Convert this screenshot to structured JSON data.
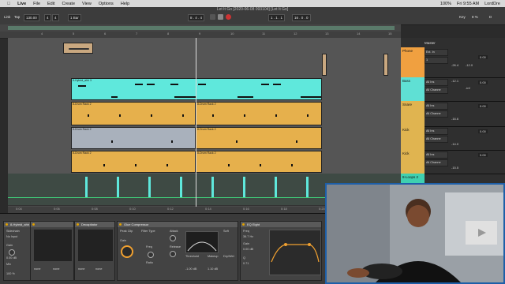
{
  "menubar": {
    "apple": "",
    "app": "Live",
    "items": [
      "File",
      "Edit",
      "Create",
      "View",
      "Options",
      "Help"
    ],
    "percent": "100%",
    "clock": "Fri 9:55 AM",
    "user": "LordDre"
  },
  "transport": {
    "title": "Let It Go  [2020-06-08 093104]  [Let It Go]",
    "link": "Link",
    "tap": "Tap",
    "tempo": "130.00",
    "sig_num": "4",
    "sig_den": "4",
    "bar": "1 Bar",
    "position": "8 . 4 . 4",
    "loop_start": "1 . 1 . 1",
    "loop_len": "16 . 0 . 0",
    "key": "Key",
    "cpu": "8 %",
    "midi": "D"
  },
  "ruler": [
    "4",
    "5",
    "6",
    "7",
    "8",
    "9",
    "10",
    "11",
    "12",
    "13",
    "14",
    "15"
  ],
  "timeline": [
    "0:04",
    "0:06",
    "0:08",
    "0:10",
    "0:12",
    "0:14",
    "0:16",
    "0:18",
    "0:20",
    "0:22"
  ],
  "clips": {
    "bass": "8-Hybrid_ahh 3",
    "snare1": "8-Drum Rack 2",
    "snare2": "8-Drum Rack 2",
    "kick1": "8-Drum Rack 2",
    "kick2": "8-Drum Rack 2",
    "kick3": "8-Drum Rack 2",
    "kick4": "8-Drum Rack 2"
  },
  "mixer": {
    "master": "Master",
    "tracks": [
      {
        "name": "Phone",
        "color": "#f0a040",
        "input": "Ext. In",
        "ch": "1",
        "db": "0.00",
        "vol": "-26.4",
        "pan": "-12.0"
      },
      {
        "name": "Bass",
        "color": "#5fe0d4",
        "input": "All Ins",
        "ch": "All Channe",
        "db": "0.00",
        "vol": "-12.1",
        "pan": "C"
      },
      {
        "name": "Snare",
        "color": "#e0b450",
        "input": "All Ins",
        "ch": "All Channe",
        "db": "0.00",
        "vol": "-16.6",
        "pan": "C"
      },
      {
        "name": "Kick",
        "color": "#e0b450",
        "input": "All Ins",
        "ch": "All Channe",
        "db": "0.00",
        "vol": "-14.0",
        "pan": "C"
      },
      {
        "name": "Kick",
        "color": "#e0b450",
        "input": "All Ins",
        "ch": "All Channe",
        "db": "0.00",
        "vol": "-15.5",
        "pan": "C"
      }
    ],
    "extra": "8-Loops 2",
    "sends": "-inf"
  },
  "devices": {
    "hybrid": "8-Hybrid_ahh 3",
    "sidechain": "Sidechain",
    "no_input": "No Input",
    "gain": "Gain",
    "mix": "Mix",
    "decapitator": "Decapitator",
    "glue": "Glue Compressor",
    "eq": "EQ Eight",
    "attack": "Attack",
    "release": "Release",
    "ratio": "Ratio",
    "threshold": "Threshold",
    "makeup": "Makeup",
    "threshold_val": "-1.00 dB",
    "makeup_val": "1.10 dB",
    "peak_clip": "Peak Clip",
    "filter_type": "Filter Type",
    "freq": "Freq",
    "freq_val": "36.7 Hz",
    "eq_gain": "Gain",
    "eq_gain_val": "0.00 dB",
    "q": "Q",
    "q_val": "0.71",
    "dry_wet": "Dry/Wet",
    "dry_wet_val": "100 %",
    "mode": "Mode",
    "gain_val": "0.00 dB",
    "soft": "Soft",
    "none": "none",
    "range": "Range",
    "scale": "Scale",
    "adapt": "Adapt Q",
    "on": "On"
  },
  "colors": {
    "bass": "#5fe8dc",
    "drum": "#e6b04c",
    "gray": "#a9b1bc",
    "overlay_border": "#1e5fa8"
  }
}
